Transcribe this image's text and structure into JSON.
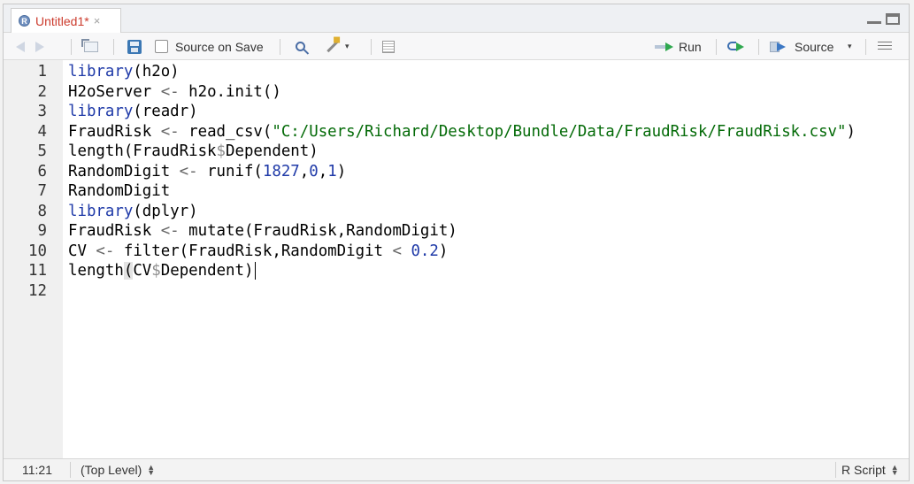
{
  "tab": {
    "title": "Untitled1*",
    "close": "×",
    "badge": "R"
  },
  "toolbar": {
    "source_on_save": "Source on Save",
    "run": "Run",
    "source": "Source",
    "caret": "▾"
  },
  "editor": {
    "lines": [
      {
        "n": "1",
        "tokens": [
          [
            "kw",
            "library"
          ],
          [
            "",
            "(h2o)"
          ]
        ]
      },
      {
        "n": "2",
        "tokens": [
          [
            "",
            "H2oServer "
          ],
          [
            "op",
            "<-"
          ],
          [
            "",
            " h2o.init()"
          ]
        ]
      },
      {
        "n": "3",
        "tokens": [
          [
            "kw",
            "library"
          ],
          [
            "",
            "(readr)"
          ]
        ]
      },
      {
        "n": "4",
        "tokens": [
          [
            "",
            "FraudRisk "
          ],
          [
            "op",
            "<-"
          ],
          [
            "",
            " read_csv("
          ],
          [
            "str",
            "\"C:/Users/Richard/Desktop/Bundle/Data/FraudRisk/FraudRisk.csv\""
          ],
          [
            "",
            ")"
          ]
        ]
      },
      {
        "n": "5",
        "tokens": [
          [
            "",
            "length(FraudRisk"
          ],
          [
            "dollar",
            "$"
          ],
          [
            "",
            "Dependent)"
          ]
        ]
      },
      {
        "n": "6",
        "tokens": [
          [
            "",
            "RandomDigit "
          ],
          [
            "op",
            "<-"
          ],
          [
            "",
            " runif("
          ],
          [
            "num",
            "1827"
          ],
          [
            "",
            ","
          ],
          [
            "num",
            "0"
          ],
          [
            "",
            ","
          ],
          [
            "num",
            "1"
          ],
          [
            "",
            ")"
          ]
        ]
      },
      {
        "n": "7",
        "tokens": [
          [
            "",
            "RandomDigit"
          ]
        ]
      },
      {
        "n": "8",
        "tokens": [
          [
            "kw",
            "library"
          ],
          [
            "",
            "(dplyr)"
          ]
        ]
      },
      {
        "n": "9",
        "tokens": [
          [
            "",
            "FraudRisk "
          ],
          [
            "op",
            "<-"
          ],
          [
            "",
            " mutate(FraudRisk,RandomDigit)"
          ]
        ]
      },
      {
        "n": "10",
        "tokens": [
          [
            "",
            "CV "
          ],
          [
            "op",
            "<-"
          ],
          [
            "",
            " filter(FraudRisk,RandomDigit "
          ],
          [
            "op",
            "<"
          ],
          [
            "",
            " "
          ],
          [
            "num",
            "0.2"
          ],
          [
            "",
            ")"
          ]
        ]
      },
      {
        "n": "11",
        "tokens": [
          [
            "",
            "length"
          ],
          [
            "bracket-hl",
            "("
          ],
          [
            "",
            "CV"
          ],
          [
            "dollar",
            "$"
          ],
          [
            "",
            "Dependent)"
          ],
          [
            "cursor",
            ""
          ]
        ]
      },
      {
        "n": "12",
        "tokens": []
      }
    ]
  },
  "status": {
    "position": "11:21",
    "scope": "(Top Level)",
    "filetype": "R Script"
  }
}
